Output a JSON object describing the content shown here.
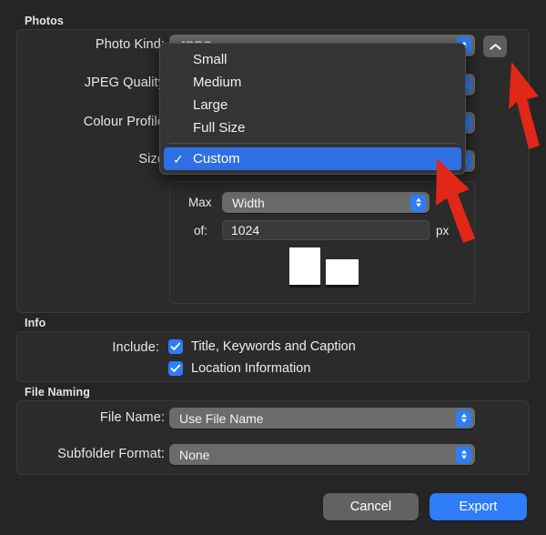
{
  "window": {
    "background_color": "#252525",
    "accent_color": "#2e7cf6"
  },
  "groups": {
    "photos": {
      "label": "Photos"
    },
    "info": {
      "label": "Info"
    },
    "file_naming": {
      "label": "File Naming"
    }
  },
  "photos": {
    "photo_kind": {
      "label": "Photo Kind:",
      "value": "JPEG"
    },
    "jpeg_quality": {
      "label": "JPEG Quality"
    },
    "colour_profile": {
      "label": "Colour Profile"
    },
    "size": {
      "label": "Size"
    },
    "max": {
      "label": "Max",
      "value": "Width"
    },
    "of": {
      "label": "of:",
      "value": "1024",
      "unit": "px"
    },
    "orientation": {
      "portrait_name": "portrait-orientation",
      "landscape_name": "landscape-orientation"
    }
  },
  "size_menu": {
    "open": true,
    "items": [
      {
        "label": "Small",
        "selected": false
      },
      {
        "label": "Medium",
        "selected": false
      },
      {
        "label": "Large",
        "selected": false
      },
      {
        "label": "Full Size",
        "selected": false
      }
    ],
    "separator_after": 4,
    "custom": {
      "label": "Custom",
      "selected": true,
      "check": "✓"
    }
  },
  "info": {
    "include_label": "Include:",
    "checkboxes": [
      {
        "label": "Title, Keywords and Caption",
        "checked": true
      },
      {
        "label": "Location Information",
        "checked": true
      }
    ]
  },
  "file_naming": {
    "file_name": {
      "label": "File Name:",
      "value": "Use File Name"
    },
    "subfolder_format": {
      "label": "Subfolder Format:",
      "value": "None"
    }
  },
  "footer": {
    "cancel_label": "Cancel",
    "export_label": "Export"
  },
  "toolbar": {
    "collapse_icon": "chevron-up-icon"
  },
  "annotations": {
    "arrow_color": "#e02718",
    "arrow_1_name": "red-arrow-to-collapse-button",
    "arrow_2_name": "red-arrow-to-custom-menu-item"
  }
}
